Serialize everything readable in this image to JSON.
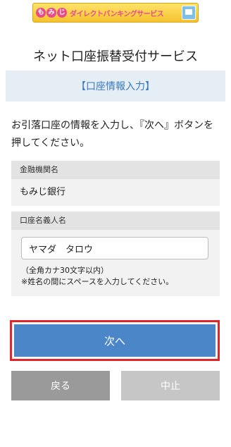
{
  "banner": {
    "circles": [
      "も",
      "み",
      "じ"
    ],
    "text": "ダイレクトバンキングサービス",
    "accent_color": "#e94b8a",
    "icon": "computer-icon"
  },
  "page_title": "ネット口座振替受付サービス",
  "section_header": "【口座情報入力】",
  "instructions": "お引落口座の情報を入力し、『次へ』ボタンを押してください。",
  "bank": {
    "label": "金融機関名",
    "value": "もみじ銀行"
  },
  "account_name": {
    "label": "口座名義人名",
    "value": "ヤマダ　タロウ",
    "hint_line1": "（全角カナ30文字以内）",
    "hint_line2": "※姓名の間にスペースを入力してください。"
  },
  "buttons": {
    "next": "次へ",
    "back": "戻る",
    "cancel": "中止"
  },
  "colors": {
    "next_button": "#4a86c8",
    "highlight_border": "#e0262d",
    "section_header_text": "#3a78c2"
  }
}
